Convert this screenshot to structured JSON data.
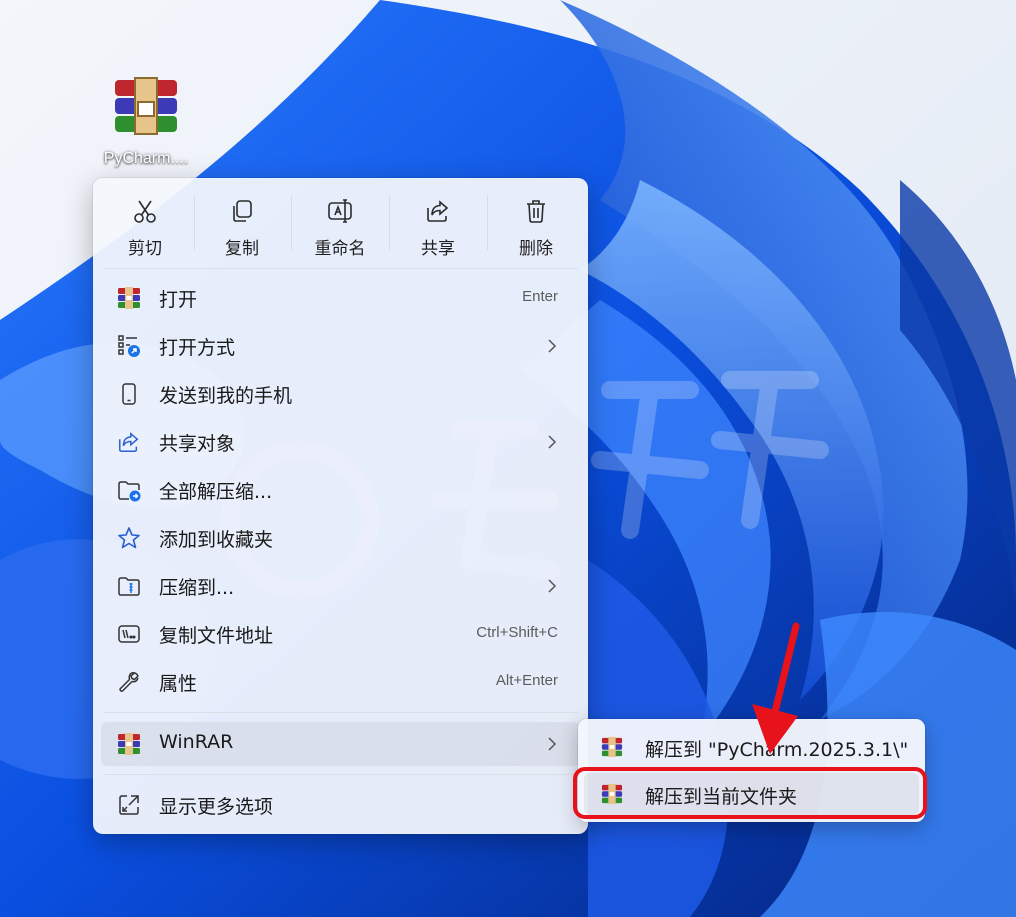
{
  "desktop": {
    "icon_label": "PyCharm....",
    "icon_name": "winrar-archive-icon"
  },
  "menu": {
    "toolbar": [
      {
        "label": "剪切",
        "icon": "cut-icon"
      },
      {
        "label": "复制",
        "icon": "copy-icon"
      },
      {
        "label": "重命名",
        "icon": "rename-icon"
      },
      {
        "label": "共享",
        "icon": "share-icon"
      },
      {
        "label": "删除",
        "icon": "delete-icon"
      }
    ],
    "items": [
      {
        "label": "打开",
        "shortcut": "Enter",
        "icon": "winrar-icon"
      },
      {
        "label": "打开方式",
        "submenu": true,
        "icon": "open-with-icon"
      },
      {
        "label": "发送到我的手机",
        "icon": "phone-icon"
      },
      {
        "label": "共享对象",
        "submenu": true,
        "icon": "share-icon"
      },
      {
        "label": "全部解压缩...",
        "icon": "extract-folder-icon"
      },
      {
        "label": "添加到收藏夹",
        "icon": "star-icon"
      },
      {
        "label": "压缩到...",
        "submenu": true,
        "icon": "zip-folder-icon"
      },
      {
        "label": "复制文件地址",
        "shortcut": "Ctrl+Shift+C",
        "icon": "copy-path-icon"
      },
      {
        "label": "属性",
        "shortcut": "Alt+Enter",
        "icon": "wrench-icon"
      }
    ],
    "winrar": {
      "label": "WinRAR",
      "submenu": true,
      "icon": "winrar-icon"
    },
    "more_options": {
      "label": "显示更多选项",
      "icon": "external-icon"
    }
  },
  "submenu": {
    "items": [
      {
        "label": "解压到 \"PyCharm.2025.3.1\\\"",
        "icon": "winrar-icon"
      },
      {
        "label": "解压到当前文件夹",
        "icon": "winrar-icon",
        "highlighted": true
      }
    ]
  },
  "annotation": {
    "arrow_color": "#e8121a",
    "highlight_color": "#e8121a"
  }
}
